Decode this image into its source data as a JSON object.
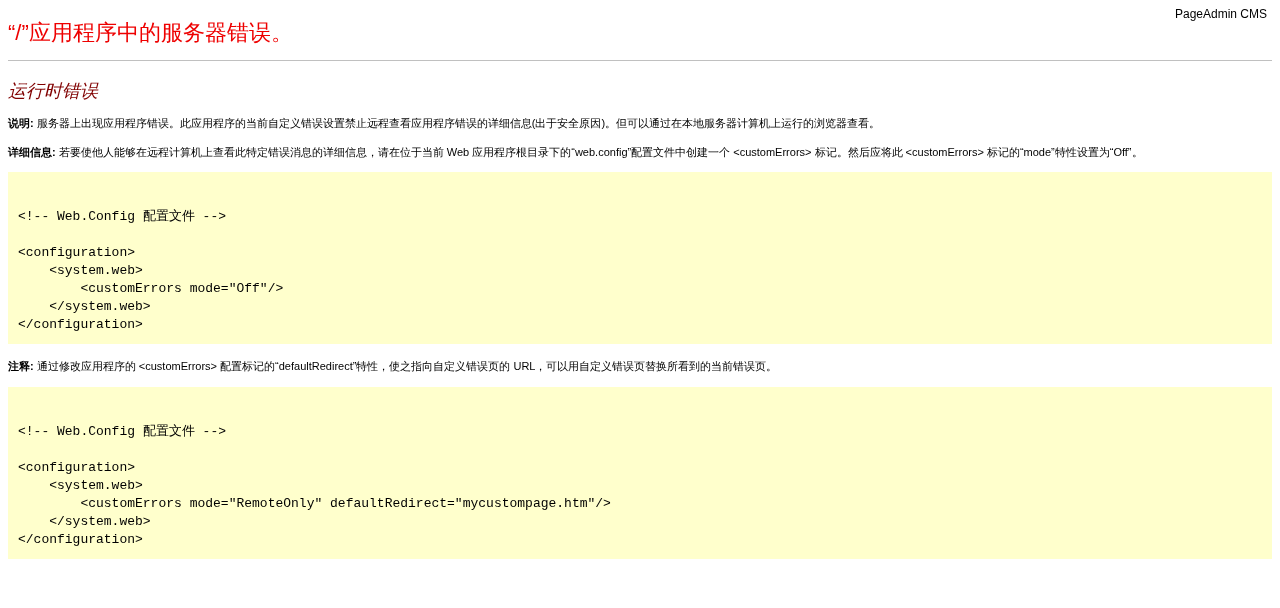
{
  "brand": "PageAdmin CMS",
  "title": "“/”应用程序中的服务器错误。",
  "subtitle": "运行时错误",
  "sections": [
    {
      "kind": "paragraph",
      "text": "**说明:** 服务器上出现应用程序错误。此应用程序的当前自定义错误设置禁止远程查看应用程序错误的详细信息(出于安全原因)。但可以通过在本地服务器计算机上运行的浏览器查看。"
    },
    {
      "kind": "paragraph",
      "text": "**详细信息:** 若要使他人能够在远程计算机上查看此特定错误消息的详细信息，请在位于当前 Web 应用程序根目录下的“web.config”配置文件中创建一个 <customErrors> 标记。然后应将此 <customErrors> 标记的“mode”特性设置为“Off”。"
    },
    {
      "kind": "code",
      "text": "<!-- Web.Config 配置文件 -->\n\n<configuration>\n    <system.web>\n        <customErrors mode=\"Off\"/>\n    </system.web>\n</configuration>"
    },
    {
      "kind": "paragraph",
      "text": "**注释:** 通过修改应用程序的 <customErrors> 配置标记的“defaultRedirect”特性，使之指向自定义错误页的 URL，可以用自定义错误页替换所看到的当前错误页。"
    },
    {
      "kind": "code",
      "text": "<!-- Web.Config 配置文件 -->\n\n<configuration>\n    <system.web>\n        <customErrors mode=\"RemoteOnly\" defaultRedirect=\"mycustompage.htm\"/>\n    </system.web>\n</configuration>"
    }
  ]
}
